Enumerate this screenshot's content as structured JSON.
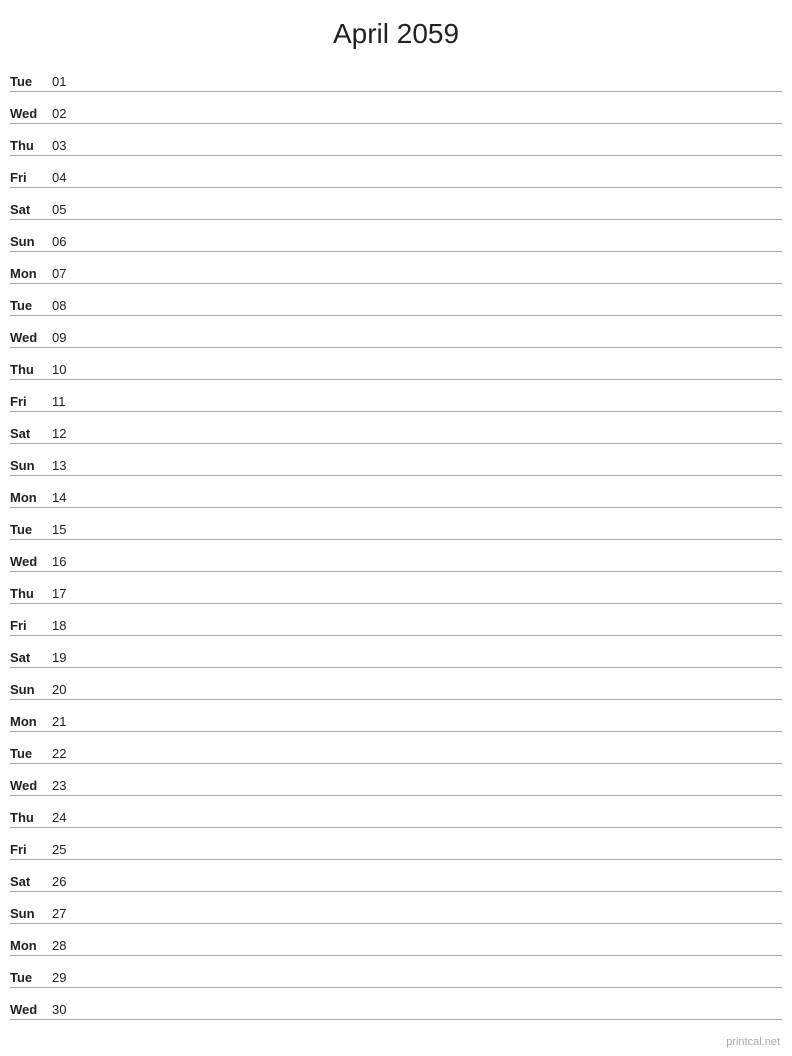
{
  "header": {
    "title": "April 2059"
  },
  "days": [
    {
      "name": "Tue",
      "number": "01"
    },
    {
      "name": "Wed",
      "number": "02"
    },
    {
      "name": "Thu",
      "number": "03"
    },
    {
      "name": "Fri",
      "number": "04"
    },
    {
      "name": "Sat",
      "number": "05"
    },
    {
      "name": "Sun",
      "number": "06"
    },
    {
      "name": "Mon",
      "number": "07"
    },
    {
      "name": "Tue",
      "number": "08"
    },
    {
      "name": "Wed",
      "number": "09"
    },
    {
      "name": "Thu",
      "number": "10"
    },
    {
      "name": "Fri",
      "number": "11"
    },
    {
      "name": "Sat",
      "number": "12"
    },
    {
      "name": "Sun",
      "number": "13"
    },
    {
      "name": "Mon",
      "number": "14"
    },
    {
      "name": "Tue",
      "number": "15"
    },
    {
      "name": "Wed",
      "number": "16"
    },
    {
      "name": "Thu",
      "number": "17"
    },
    {
      "name": "Fri",
      "number": "18"
    },
    {
      "name": "Sat",
      "number": "19"
    },
    {
      "name": "Sun",
      "number": "20"
    },
    {
      "name": "Mon",
      "number": "21"
    },
    {
      "name": "Tue",
      "number": "22"
    },
    {
      "name": "Wed",
      "number": "23"
    },
    {
      "name": "Thu",
      "number": "24"
    },
    {
      "name": "Fri",
      "number": "25"
    },
    {
      "name": "Sat",
      "number": "26"
    },
    {
      "name": "Sun",
      "number": "27"
    },
    {
      "name": "Mon",
      "number": "28"
    },
    {
      "name": "Tue",
      "number": "29"
    },
    {
      "name": "Wed",
      "number": "30"
    }
  ],
  "watermark": "printcal.net"
}
